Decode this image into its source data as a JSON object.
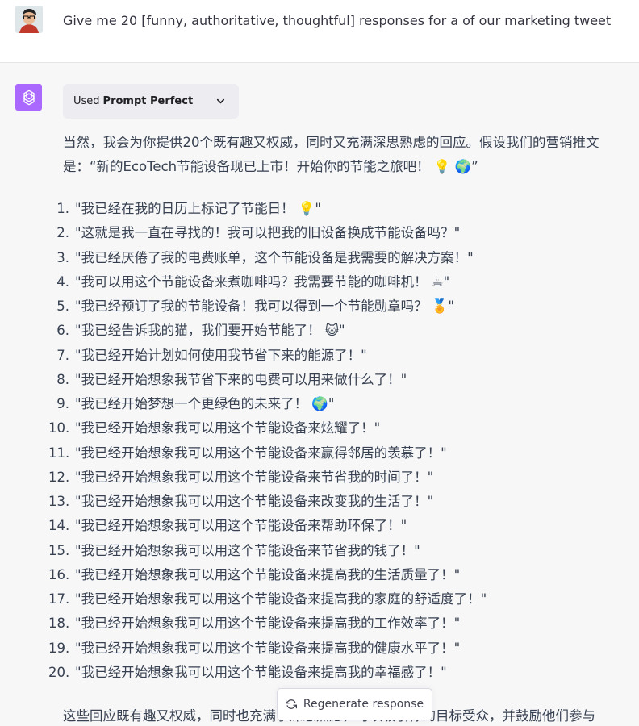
{
  "user_message": {
    "text": "Give me 20 [funny, authoritative, thoughtful] responses for a of our marketing tweet"
  },
  "assistant": {
    "plugin": {
      "used_label": "Used",
      "plugin_name": "Prompt Perfect"
    },
    "intro_line1": "当然，我会为你提供20个既有趣又权威，同时又充满深思熟虑的回应。假设我们的营销推文",
    "intro_line2": "是：“新的EcoTech节能设备现已上市！开始你的节能之旅吧！ 💡 🌍”",
    "responses": [
      {
        "num": "1.",
        "text": "\"我已经在我的日历上标记了节能日！ 💡\""
      },
      {
        "num": "2.",
        "text": "\"这就是我一直在寻找的！我可以把我的旧设备换成节能设备吗？\""
      },
      {
        "num": "3.",
        "text": "\"我已经厌倦了我的电费账单，这个节能设备是我需要的解决方案！\""
      },
      {
        "num": "4.",
        "text": "\"我可以用这个节能设备来煮咖啡吗？我需要节能的咖啡机！ ☕\""
      },
      {
        "num": "5.",
        "text": "\"我已经预订了我的节能设备！我可以得到一个节能勋章吗？ 🏅\""
      },
      {
        "num": "6.",
        "text": "\"我已经告诉我的猫，我们要开始节能了！ 😺\""
      },
      {
        "num": "7.",
        "text": "\"我已经开始计划如何使用我节省下来的能源了！\""
      },
      {
        "num": "8.",
        "text": "\"我已经开始想象我节省下来的电费可以用来做什么了！\""
      },
      {
        "num": "9.",
        "text": "\"我已经开始梦想一个更绿色的未来了！ 🌍\""
      },
      {
        "num": "10.",
        "text": "\"我已经开始想象我可以用这个节能设备来炫耀了！\""
      },
      {
        "num": "11.",
        "text": "\"我已经开始想象我可以用这个节能设备来赢得邻居的羡慕了！\""
      },
      {
        "num": "12.",
        "text": "\"我已经开始想象我可以用这个节能设备来节省我的时间了！\""
      },
      {
        "num": "13.",
        "text": "\"我已经开始想象我可以用这个节能设备来改变我的生活了！\""
      },
      {
        "num": "14.",
        "text": "\"我已经开始想象我可以用这个节能设备来帮助环保了！\""
      },
      {
        "num": "15.",
        "text": "\"我已经开始想象我可以用这个节能设备来节省我的钱了！\""
      },
      {
        "num": "16.",
        "text": "\"我已经开始想象我可以用这个节能设备来提高我的生活质量了！\""
      },
      {
        "num": "17.",
        "text": "\"我已经开始想象我可以用这个节能设备来提高我的家庭的舒适度了！\""
      },
      {
        "num": "18.",
        "text": "\"我已经开始想象我可以用这个节能设备来提高我的工作效率了！\""
      },
      {
        "num": "19.",
        "text": "\"我已经开始想象我可以用这个节能设备来提高我的健康水平了！\""
      },
      {
        "num": "20.",
        "text": "\"我已经开始想象我可以用这个节能设备来提高我的幸福感了！\""
      }
    ],
    "outro": "这些回应既有趣又权威，同时也充满了深思熟虑，可以吸引你的目标受众，并鼓励他们参与"
  },
  "regenerate_label": "Regenerate response",
  "colors": {
    "assistant_avatar_bg": "#ab68ff",
    "assistant_row_bg": "#f7f7f8",
    "user_row_bg": "#ffffff"
  }
}
